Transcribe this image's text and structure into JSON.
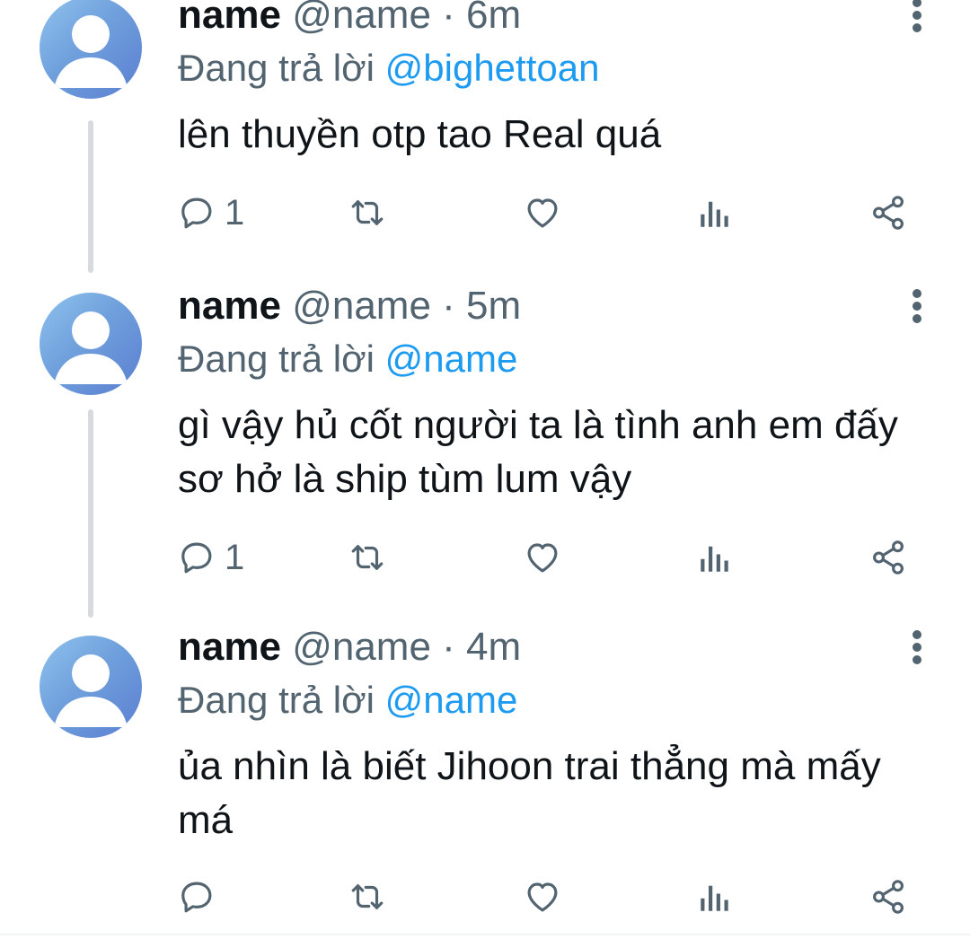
{
  "tweets": [
    {
      "name": "name",
      "handle": "@name",
      "dot": "·",
      "time": "6m",
      "replying_prefix": "Đang trả lời",
      "replying_to": "@bighettoan",
      "text": "lên thuyền otp tao Real quá",
      "reply_count": "1",
      "retweet_count": "",
      "like_count": ""
    },
    {
      "name": "name",
      "handle": "@name",
      "dot": "·",
      "time": "5m",
      "replying_prefix": "Đang trả lời",
      "replying_to": "@name",
      "text": "gì vậy hủ cốt người ta là tình anh em đấy sơ hở là ship tùm lum vậy",
      "reply_count": "1",
      "retweet_count": "",
      "like_count": ""
    },
    {
      "name": "name",
      "handle": "@name",
      "dot": "·",
      "time": "4m",
      "replying_prefix": "Đang trả lời",
      "replying_to": "@name",
      "text": "ủa nhìn là biết Jihoon trai thẳng mà mấy má",
      "reply_count": "",
      "retweet_count": "",
      "like_count": ""
    }
  ],
  "icons": {
    "reply": "reply-icon",
    "retweet": "retweet-icon",
    "like": "heart-icon",
    "views": "analytics-icon",
    "share": "share-icon",
    "more": "more-options-icon",
    "avatar": "default-avatar-icon"
  },
  "colors": {
    "text": "#0f1419",
    "secondary": "#536471",
    "mention": "#1d9bf0",
    "thread_line": "#d7dbdf",
    "avatar_start": "#8fc3ee",
    "avatar_end": "#5b7ed1"
  }
}
